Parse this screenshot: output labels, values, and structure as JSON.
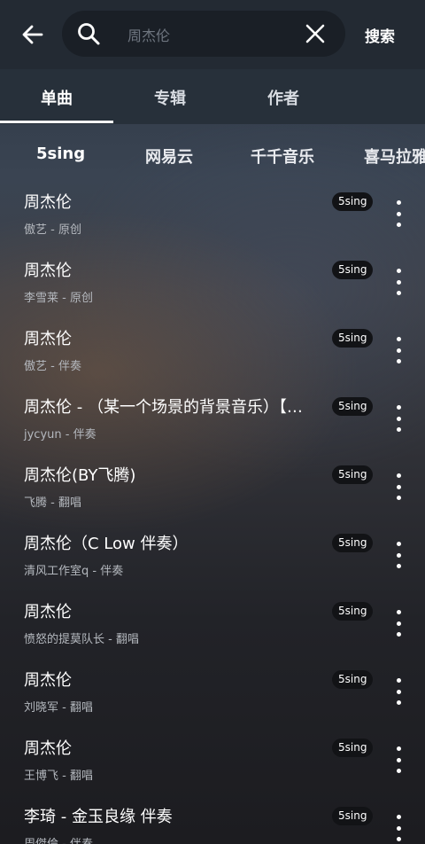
{
  "header": {
    "back_icon": "arrow-left-icon",
    "search_icon": "search-icon",
    "search_query": "周杰伦",
    "clear_icon": "close-icon",
    "search_button_label": "搜索"
  },
  "tabs": [
    {
      "label": "单曲",
      "active": true
    },
    {
      "label": "专辑",
      "active": false
    },
    {
      "label": "作者",
      "active": false
    }
  ],
  "sources": [
    {
      "label": "5sing",
      "active": true
    },
    {
      "label": "网易云",
      "active": false
    },
    {
      "label": "千千音乐",
      "active": false
    },
    {
      "label": "喜马拉雅",
      "active": false
    }
  ],
  "results": [
    {
      "title": "周杰伦",
      "subtitle": "傲艺 - 原创",
      "badge": "5sing"
    },
    {
      "title": "周杰伦",
      "subtitle": "李雪莱 - 原创",
      "badge": "5sing"
    },
    {
      "title": "周杰伦",
      "subtitle": "傲艺 - 伴奏",
      "badge": "5sing"
    },
    {
      "title": "周杰伦 - （某一个场景的背景音乐）【…",
      "subtitle": "jycyun - 伴奏",
      "badge": "5sing"
    },
    {
      "title": "周杰伦(BY飞腾)",
      "subtitle": "飞腾 - 翻唱",
      "badge": "5sing"
    },
    {
      "title": "周杰伦（C Low 伴奏）",
      "subtitle": "清风工作室q - 伴奏",
      "badge": "5sing"
    },
    {
      "title": "周杰伦",
      "subtitle": "愤怒的提莫队长 - 翻唱",
      "badge": "5sing"
    },
    {
      "title": "周杰伦",
      "subtitle": "刘晓军 - 翻唱",
      "badge": "5sing"
    },
    {
      "title": "周杰伦",
      "subtitle": "王博飞 - 翻唱",
      "badge": "5sing"
    },
    {
      "title": "李琦 - 金玉良缘 伴奏",
      "subtitle": "周傑倫 - 伴奏",
      "badge": "5sing"
    }
  ],
  "colors": {
    "header_bg": "#232a33",
    "tabs_bg": "#27303a",
    "search_bg": "#1a1f26",
    "badge_bg": "#121316",
    "subtitle_text": "#b4b8be"
  }
}
